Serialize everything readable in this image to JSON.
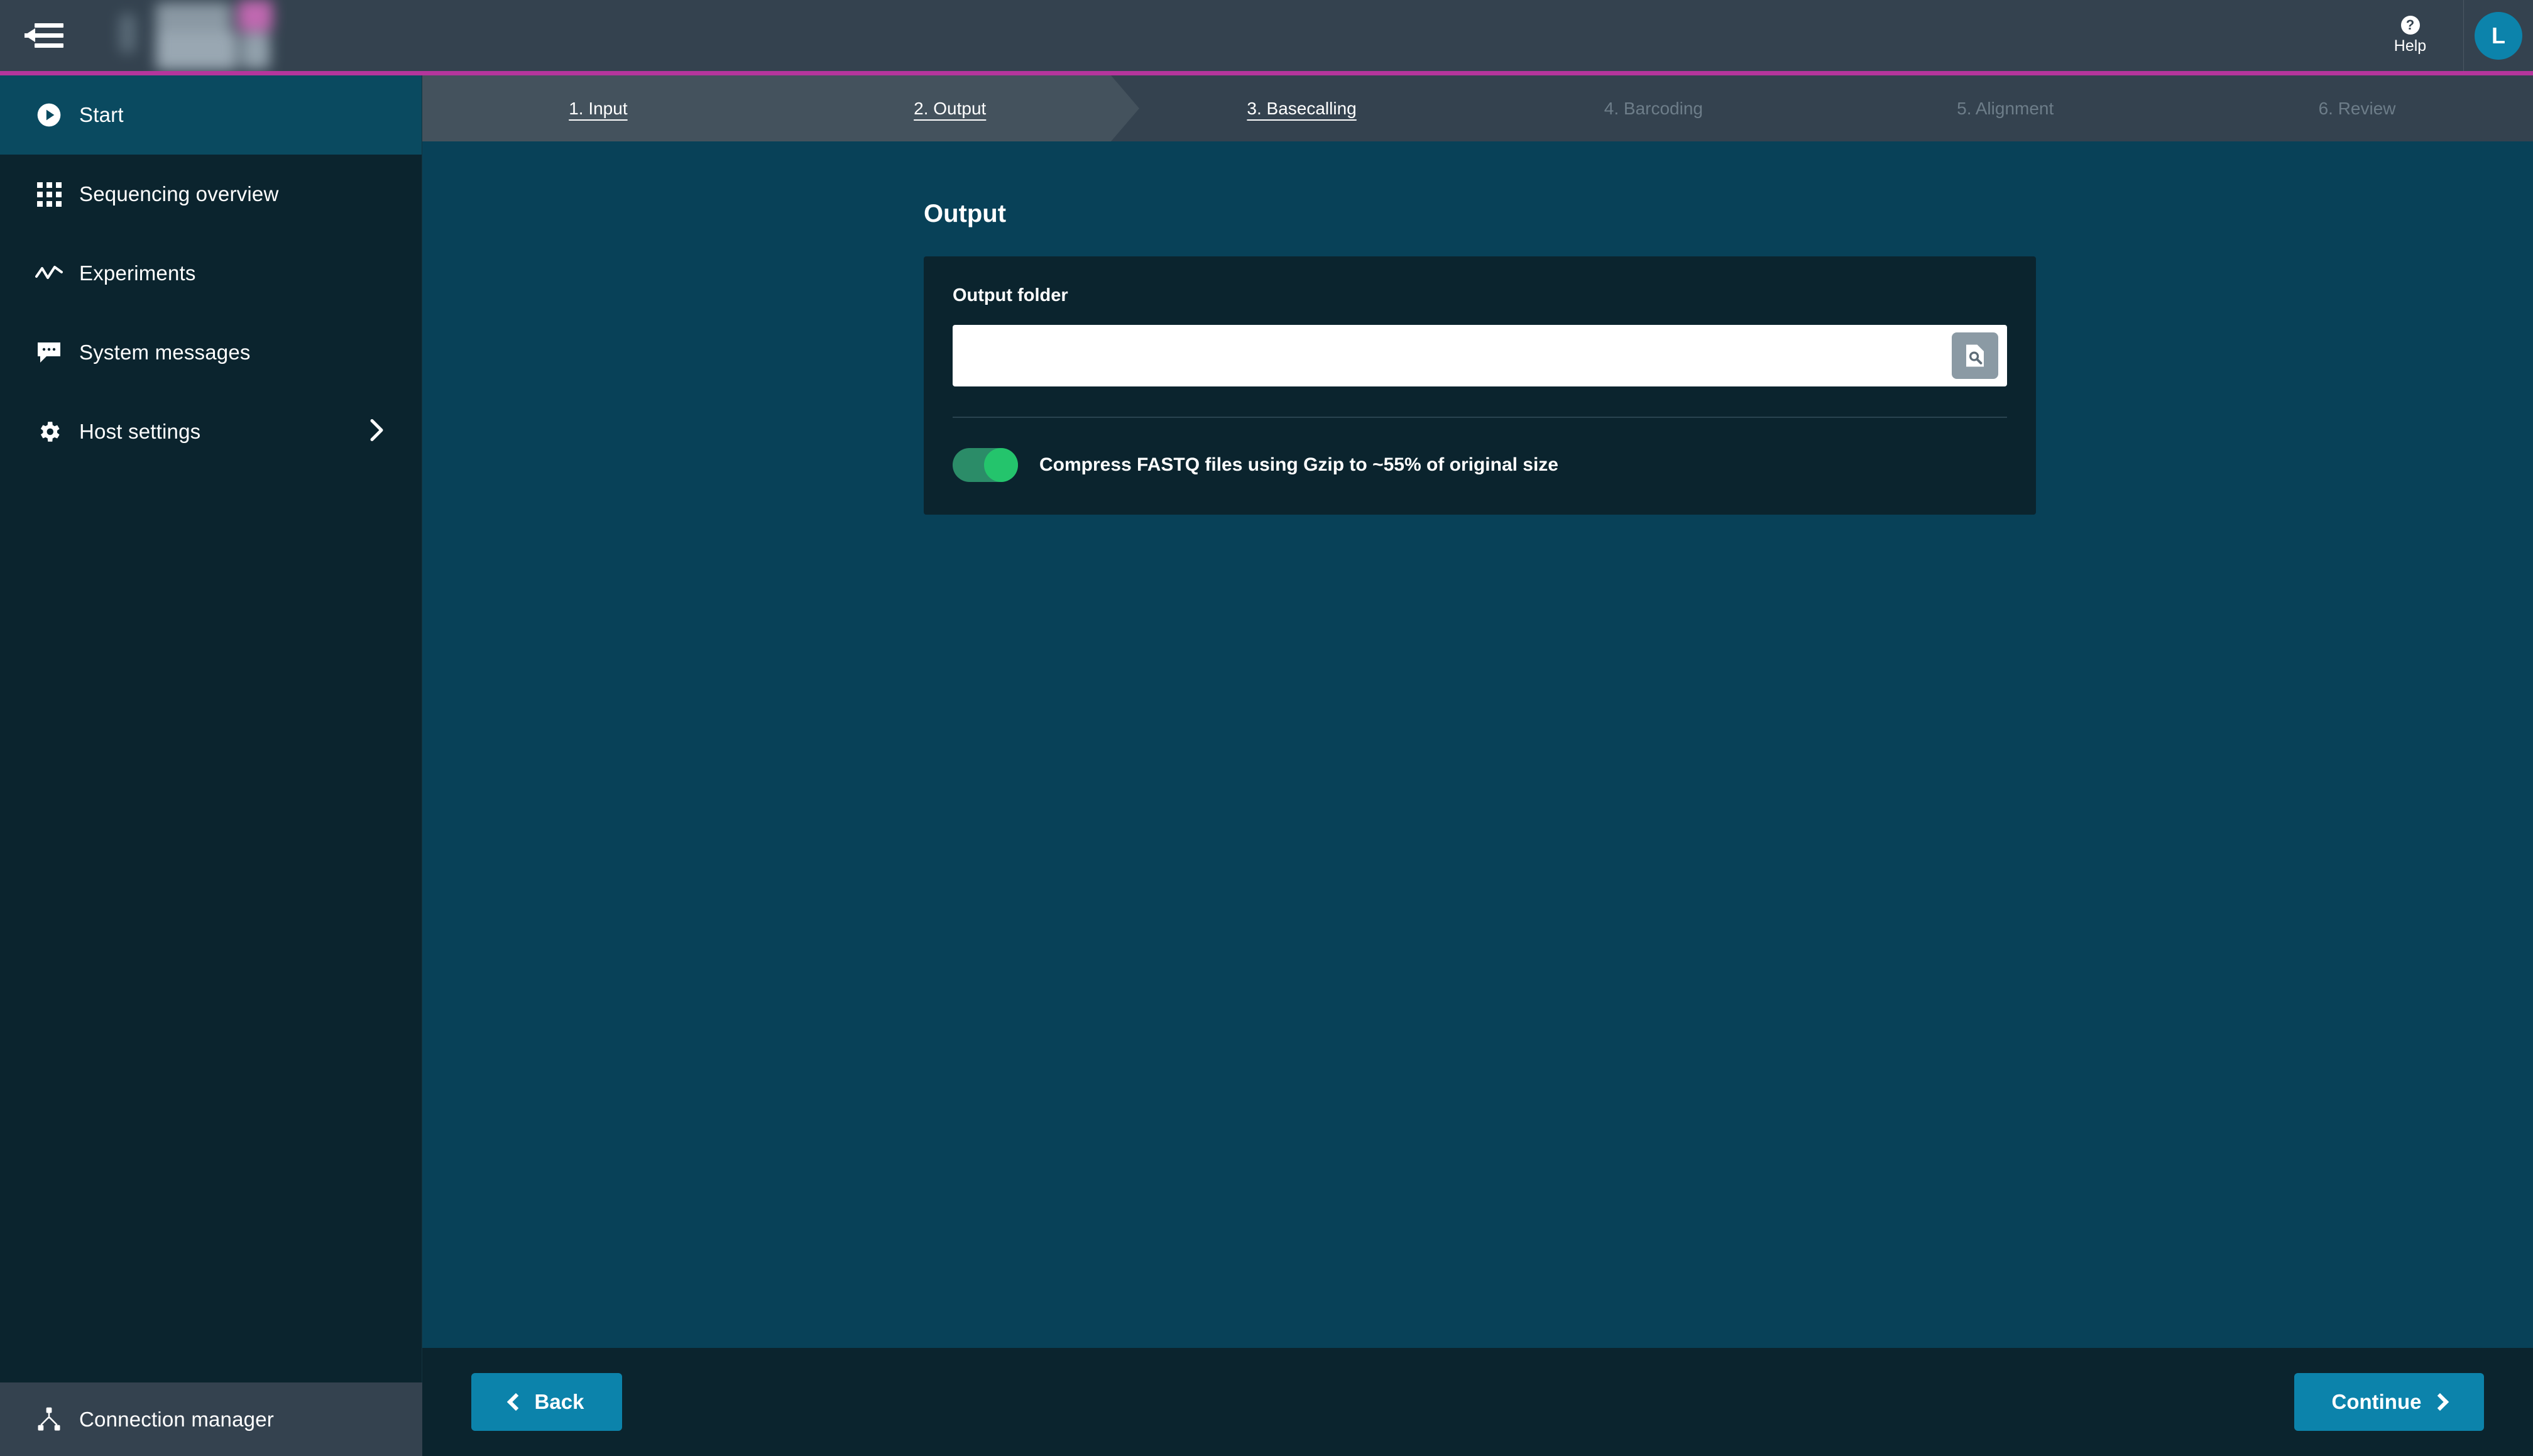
{
  "header": {
    "collapse_icon": "collapse-sidebar-icon",
    "logo_alt": "blurred-application-logo",
    "help_label": "Help",
    "help_icon": "question-mark-icon",
    "avatar_initial": "L",
    "accent_color": "#b5359c"
  },
  "sidebar": {
    "items": [
      {
        "label": "Start",
        "icon": "play-circle-icon",
        "active": true,
        "has_chevron": false
      },
      {
        "label": "Sequencing overview",
        "icon": "grid-dots-icon",
        "active": false,
        "has_chevron": false
      },
      {
        "label": "Experiments",
        "icon": "line-chart-icon",
        "active": false,
        "has_chevron": false
      },
      {
        "label": "System messages",
        "icon": "speech-bubble-icon",
        "active": false,
        "has_chevron": false
      },
      {
        "label": "Host settings",
        "icon": "gear-icon",
        "active": false,
        "has_chevron": true
      }
    ],
    "footer": {
      "label": "Connection manager",
      "icon": "connection-node-icon"
    }
  },
  "steps": [
    {
      "label": "1. Input",
      "state": "done"
    },
    {
      "label": "2. Output",
      "state": "done"
    },
    {
      "label": "3. Basecalling",
      "state": "current"
    },
    {
      "label": "4. Barcoding",
      "state": "todo"
    },
    {
      "label": "5. Alignment",
      "state": "todo"
    },
    {
      "label": "6. Review",
      "state": "todo"
    }
  ],
  "main": {
    "title": "Output",
    "output_folder": {
      "label": "Output folder",
      "value": "",
      "placeholder": "",
      "browse_icon": "file-browse-icon"
    },
    "compress": {
      "label": "Compress FASTQ files using Gzip to ~55% of original size",
      "enabled": true,
      "toggle_on_color": "#24c46c"
    }
  },
  "footer": {
    "back_label": "Back",
    "back_icon": "chevron-left-icon",
    "continue_label": "Continue",
    "continue_icon": "chevron-right-icon",
    "button_color": "#0c83ab"
  }
}
